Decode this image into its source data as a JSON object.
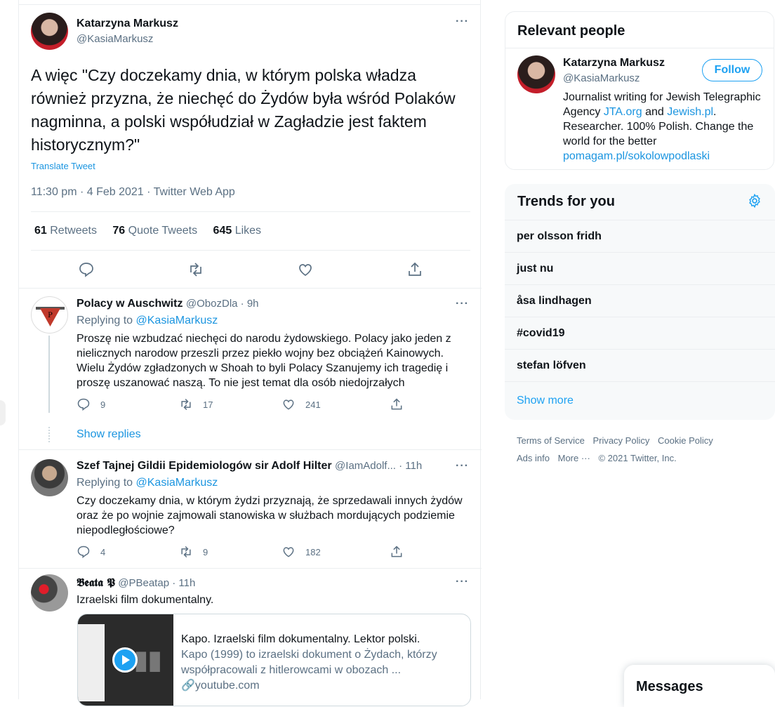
{
  "main_tweet": {
    "author_name": "Katarzyna Markusz",
    "author_handle": "@KasiaMarkusz",
    "text": "A więc \"Czy doczekamy dnia, w którym polska władza również przyzna, że niechęć do Żydów była wśród Polaków nagminna, a polski współudział w Zagładzie jest faktem historycznym?\"",
    "translate_label": "Translate Tweet",
    "meta": "11:30 pm · 4 Feb 2021 · Twitter Web App",
    "retweets_count": "61",
    "retweets_label": "Retweets",
    "quotes_count": "76",
    "quotes_label": "Quote Tweets",
    "likes_count": "645",
    "likes_label": "Likes"
  },
  "replies": [
    {
      "name": "Polacy w Auschwitz",
      "handle_time": "@ObozDla · 9h",
      "replying_prefix": "Replying to ",
      "replying_handle": "@KasiaMarkusz",
      "text": "Proszę nie wzbudzać niechęci do narodu żydowskiego. Polacy jako jeden z nielicznych narodow przeszli przez piekło wojny bez obciążeń Kainowych. Wielu Żydów zgładzonych w Shoah to byli Polacy Szanujemy ich tragedię i proszę uszanować naszą. To nie jest temat dla osób niedojrzałych",
      "reply_count": "9",
      "retweet_count": "17",
      "like_count": "241",
      "show_replies": "Show replies"
    },
    {
      "name": "Szef Tajnej Gildii Epidemiologów sir Adolf Hilter",
      "handle_time": "@IamAdolf... · 11h",
      "replying_prefix": "Replying to ",
      "replying_handle": "@KasiaMarkusz",
      "text": "Czy doczekamy dnia, w którym żydzi przyznają, że sprzedawali innych żydów oraz że po wojnie zajmowali stanowiska w służbach mordujących podziemie niepodległościowe?",
      "reply_count": "4",
      "retweet_count": "9",
      "like_count": "182"
    },
    {
      "name": "𝕭𝖊𝖆𝖙𝖆 𝕻",
      "handle_time": "@PBeatap · 11h",
      "text": "Izraelski film dokumentalny.",
      "card": {
        "title": "Kapo. Izraelski film dokumentalny. Lektor polski.",
        "description": "Kapo (1999) to izraelski dokument o Żydach, którzy współpracowali z hitlerowcami w obozach ...",
        "domain": "youtube.com"
      }
    }
  ],
  "relevant_people": {
    "title": "Relevant people",
    "name": "Katarzyna Markusz",
    "handle": "@KasiaMarkusz",
    "follow_label": "Follow",
    "bio_1": "Journalist writing for Jewish Telegraphic Agency ",
    "bio_link1": "JTA.org",
    "bio_2": " and ",
    "bio_link2": "Jewish.pl",
    "bio_3": ". Researcher. 100% Polish. Change the world for the better ",
    "bio_link3": "pomagam.pl/sokolowpodlaski"
  },
  "trends": {
    "title": "Trends for you",
    "items": [
      "per olsson fridh",
      "just nu",
      "åsa lindhagen",
      "#covid19",
      "stefan löfven"
    ],
    "show_more": "Show more"
  },
  "footer": {
    "terms": "Terms of Service",
    "privacy": "Privacy Policy",
    "cookie": "Cookie Policy",
    "ads": "Ads info",
    "more": "More ···",
    "copyright": "© 2021 Twitter, Inc."
  },
  "messages": {
    "title": "Messages"
  },
  "colors": {
    "accent": "#1da1f2",
    "link": "#1b95e0",
    "muted": "#5b7083"
  }
}
